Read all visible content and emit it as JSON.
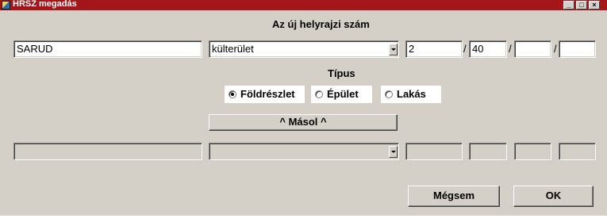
{
  "window": {
    "title": "HRSZ megadás",
    "minimize_glyph": "_",
    "maximize_glyph": "□",
    "close_glyph": "×"
  },
  "new_hrsz": {
    "heading": "Az új helyrajzi szám",
    "settlement": "SARUD",
    "area_type": "külterület",
    "part1": "2",
    "part2": "40",
    "part3": "",
    "part4": "",
    "separator": "/"
  },
  "type": {
    "heading": "Típus",
    "options": [
      {
        "label": "Földrészlet",
        "selected": true
      },
      {
        "label": "Épület",
        "selected": false
      },
      {
        "label": "Lakás",
        "selected": false
      }
    ]
  },
  "copy_button": "^ Másol ^",
  "old_hrsz": {
    "settlement": "",
    "area_type": "",
    "part1": "",
    "part2": "",
    "part3": "",
    "part4": ""
  },
  "buttons": {
    "cancel": "Mégsem",
    "ok": "OK"
  },
  "icons": {
    "app": "app-icon",
    "dropdown": "chevron-down-icon"
  }
}
